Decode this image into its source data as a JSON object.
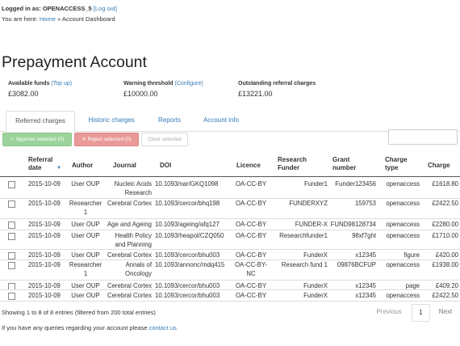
{
  "session": {
    "logged_in_prefix": "Logged in as: OPENACCESS_5",
    "logout_label": "[Log out]",
    "crumb_prefix": "You are here:",
    "crumb_home": "Home",
    "crumb_sep": "»",
    "crumb_current": "Account Dashboard"
  },
  "page": {
    "title": "Prepayment Account"
  },
  "stats": {
    "available": {
      "label": "Available funds",
      "link": "(Top up)",
      "value": "£3082.00"
    },
    "warning": {
      "label": "Warning threshold",
      "link": "(Configure)",
      "value": "£10000.00"
    },
    "outstanding": {
      "label": "Outstanding referral charges",
      "value": "£13221.00"
    }
  },
  "tabs": [
    "Referred charges",
    "Historic charges",
    "Reports",
    "Account info"
  ],
  "actions": {
    "approve": "✓ Approve selected (0)",
    "reject": "✕ Reject selected (0)",
    "clear": "Clear selected"
  },
  "table": {
    "headers": [
      "Referral date",
      "Author",
      "Journal",
      "DOI",
      "Licence",
      "Research Funder",
      "Grant number",
      "Charge type",
      "Charge"
    ],
    "rows": [
      {
        "date": "2015-10-09",
        "author": "User OUP",
        "journal": "Nucleic Acids Research",
        "doi": "10.1093/nar/GKQ1098",
        "licence": "OA-CC-BY",
        "funder": "Funder1",
        "grant": "Funder123456",
        "type": "openaccess",
        "charge": "£1618.80"
      },
      {
        "date": "2015-10-09",
        "author": "Researcher 1",
        "journal": "Cerebral Cortex",
        "doi": "10.1093/cercor/bhq198",
        "licence": "OA-CC-BY",
        "funder": "FUNDERXYZ",
        "grant": "159753",
        "type": "openaccess",
        "charge": "£2422.50"
      },
      {
        "date": "2015-10-09",
        "author": "User OUP",
        "journal": "Age and Ageing",
        "doi": "10.1093/ageing/afq127",
        "licence": "OA-CC-BY",
        "funder": "FUNDER-X",
        "grant": "FUND98128734",
        "type": "openaccess",
        "charge": "£2280.00"
      },
      {
        "date": "2015-10-09",
        "author": "User OUP",
        "journal": "Health Policy and Planning",
        "doi": "10.1093/heapol/CZQ050",
        "licence": "OA-CC-BY",
        "funder": "Researchfunder1",
        "grant": "98xf7ght",
        "type": "openaccess",
        "charge": "£1710.00"
      },
      {
        "date": "2015-10-09",
        "author": "User OUP",
        "journal": "Cerebral Cortex",
        "doi": "10.1093/cercor/bhu003",
        "licence": "OA-CC-BY",
        "funder": "FunderX",
        "grant": "x12345",
        "type": "figure",
        "charge": "£420.00"
      },
      {
        "date": "2015-10-09",
        "author": "Researcher 1",
        "journal": "Annals of Oncology",
        "doi": "10.1093/annonc/mdq415",
        "licence": "OA-CC-BY-NC",
        "funder": "Research fund 1",
        "grant": "09876BCFUP",
        "type": "openaccess",
        "charge": "£1938.00"
      },
      {
        "date": "2015-10-09",
        "author": "User OUP",
        "journal": "Cerebral Cortex",
        "doi": "10.1093/cercor/bhu003",
        "licence": "OA-CC-BY",
        "funder": "FunderX",
        "grant": "x12345",
        "type": "page",
        "charge": "£409.20"
      },
      {
        "date": "2015-10-09",
        "author": "User OUP",
        "journal": "Cerebral Cortex",
        "doi": "10.1093/cercor/bhu003",
        "licence": "OA-CC-BY",
        "funder": "FunderX",
        "grant": "x12345",
        "type": "openaccess",
        "charge": "£2422.50"
      }
    ]
  },
  "pagination": {
    "info": "Showing 1 to 8 of 8 entries (filtered from 200 total entries)",
    "prev": "Previous",
    "page": "1",
    "next": "Next"
  },
  "footer": {
    "text": "If you have any queries regarding your account please",
    "link": "contact us."
  }
}
